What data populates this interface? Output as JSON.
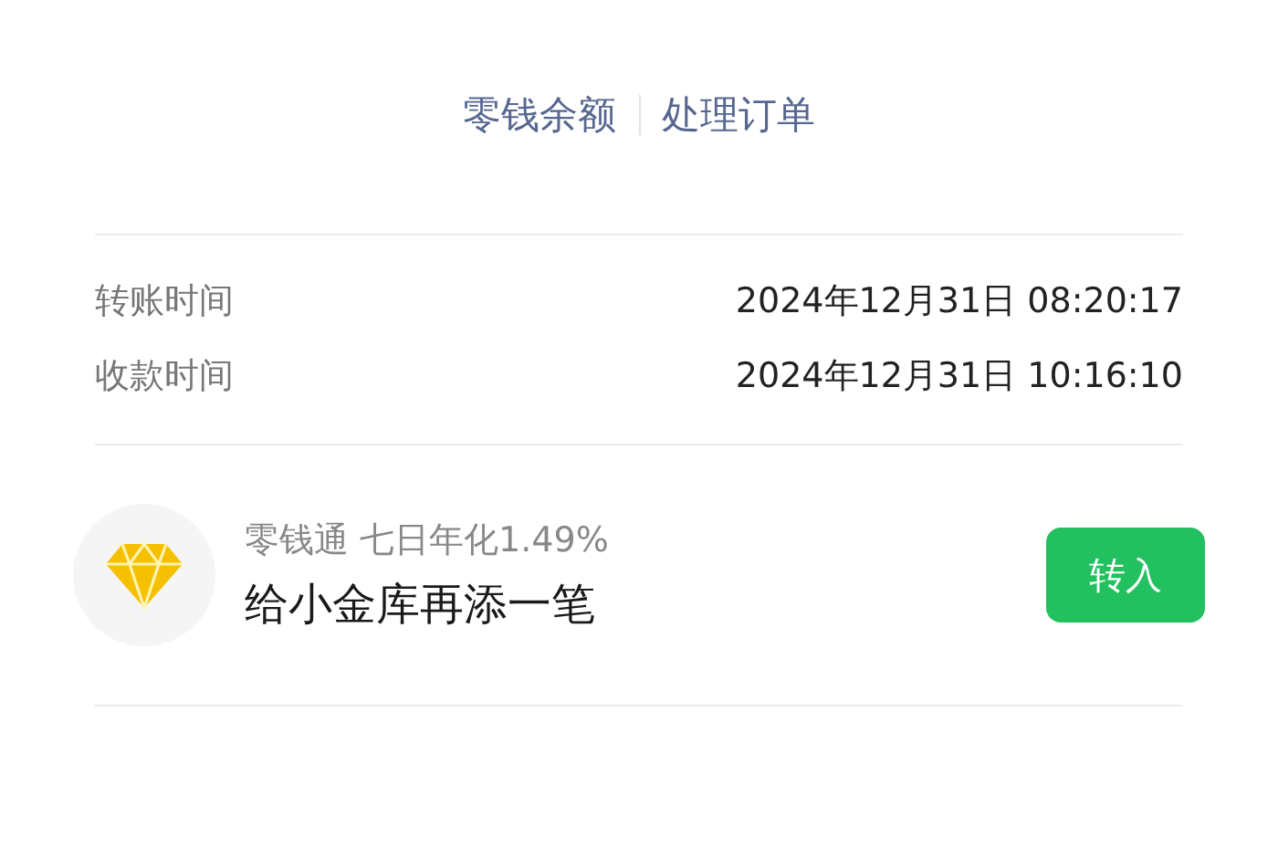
{
  "links": [
    "零钱余额",
    "处理订单"
  ],
  "details": [
    {
      "label": "转账时间",
      "value": "2024年12月31日 08:20:17"
    },
    {
      "label": "收款时间",
      "value": "2024年12月31日 10:16:10"
    }
  ],
  "promo": {
    "subtitle": "零钱通 七日年化1.49%",
    "title": "给小金库再添一笔",
    "button": "转入"
  }
}
